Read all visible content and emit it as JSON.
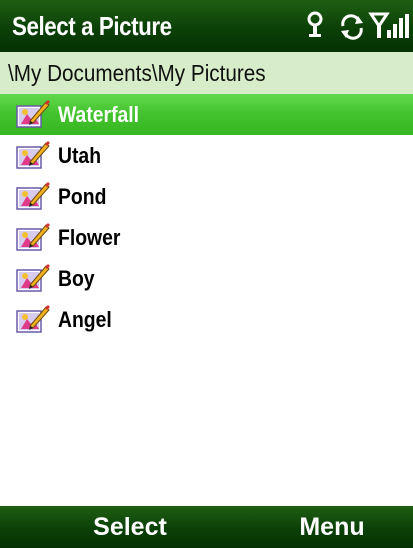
{
  "title_bar": {
    "title": "Select a Picture",
    "icons": [
      "connectivity-icon",
      "sync-icon",
      "signal-strength-icon"
    ]
  },
  "path_bar": {
    "path": "\\My Documents\\My Pictures"
  },
  "file_list": {
    "items": [
      {
        "label": "Waterfall",
        "icon": "picture-file-icon",
        "selected": true
      },
      {
        "label": "Utah",
        "icon": "picture-file-icon",
        "selected": false
      },
      {
        "label": "Pond",
        "icon": "picture-file-icon",
        "selected": false
      },
      {
        "label": "Flower",
        "icon": "picture-file-icon",
        "selected": false
      },
      {
        "label": "Boy",
        "icon": "picture-file-icon",
        "selected": false
      },
      {
        "label": "Angel",
        "icon": "picture-file-icon",
        "selected": false
      }
    ]
  },
  "softkeys": {
    "left": "Select",
    "right": "Menu"
  },
  "colors": {
    "title_bar": "#0b4007",
    "path_bar": "#d7ecc8",
    "selection": "#42c22c"
  }
}
